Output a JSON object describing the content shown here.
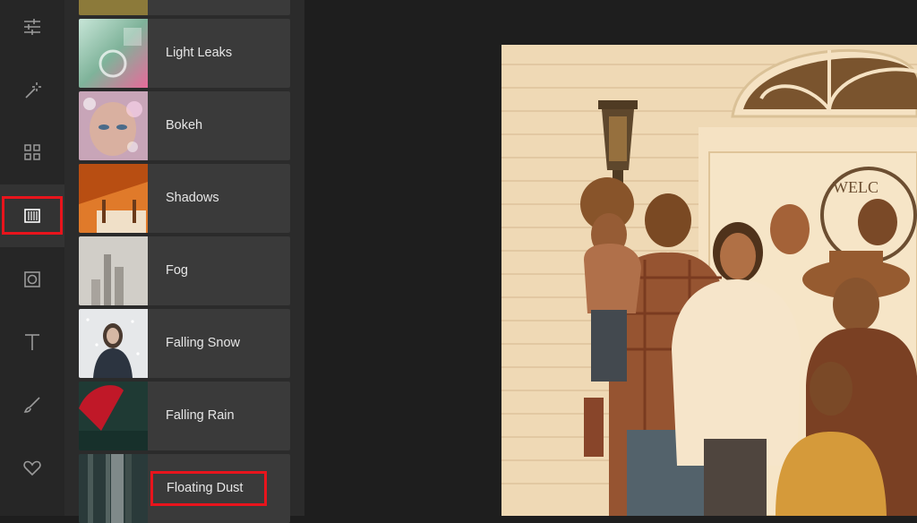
{
  "rail": {
    "tools": [
      {
        "icon": "sliders-icon"
      },
      {
        "icon": "magic-wand-icon"
      },
      {
        "icon": "grid-icon"
      },
      {
        "icon": "overlay-icon",
        "active": true
      },
      {
        "icon": "frame-icon"
      },
      {
        "icon": "text-icon"
      },
      {
        "icon": "brush-icon"
      },
      {
        "icon": "heart-icon"
      }
    ]
  },
  "overlays": {
    "items": [
      {
        "label": "Light Leaks",
        "thumb": "light-leaks-thumbnail"
      },
      {
        "label": "Bokeh",
        "thumb": "bokeh-thumbnail"
      },
      {
        "label": "Shadows",
        "thumb": "shadows-thumbnail"
      },
      {
        "label": "Fog",
        "thumb": "fog-thumbnail"
      },
      {
        "label": "Falling Snow",
        "thumb": "falling-snow-thumbnail"
      },
      {
        "label": "Falling Rain",
        "thumb": "falling-rain-thumbnail"
      },
      {
        "label": "Floating Dust",
        "thumb": "floating-dust-thumbnail",
        "highlighted": true
      }
    ]
  },
  "colors": {
    "highlight": "#e8141c",
    "rail_bg": "#262626",
    "panel_bg": "#2b2b2b",
    "item_bg": "#3a3a3a",
    "canvas_bg": "#1e1e1e"
  }
}
